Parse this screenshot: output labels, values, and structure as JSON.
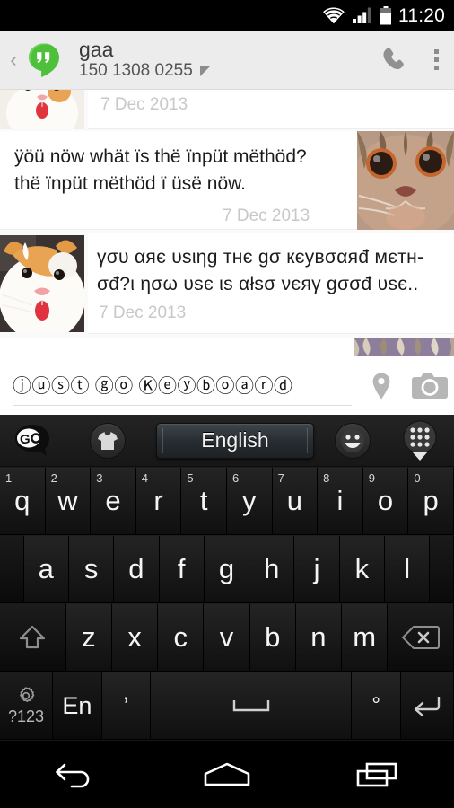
{
  "status_bar": {
    "time": "11:20",
    "icons": [
      "wifi-icon",
      "signal-icon",
      "battery-icon"
    ]
  },
  "action_bar": {
    "back_glyph": "‹",
    "app_icon": "hangouts-logo",
    "title": "gaa",
    "subtitle": "150 1308 0255",
    "call_icon": "phone-icon",
    "overflow_icon": "overflow-menu-icon"
  },
  "chat": {
    "messages": [
      {
        "id": "msg-1",
        "side": "left",
        "avatar": "cat-white-orange-avatar",
        "text": "",
        "timestamp": "7 Dec 2013"
      },
      {
        "id": "msg-2",
        "side": "right",
        "avatar": "cat-tabby-avatar",
        "text": "ÿöü nöw whät ïs thë ïnpüt mëthöd? thë ïnpüt mëthöd ï üsë nöw.",
        "line1": "ÿöü nöw whät ïs thë ïnpüt mëthöd?",
        "line2": "thë ïnpüt mëthöd ï üsë nöw.",
        "timestamp": "7 Dec 2013"
      },
      {
        "id": "msg-3",
        "side": "left",
        "avatar": "cat-orange-white-avatar",
        "text": "γσυ αяє υsιηg тнє gσ  кєувσαяđ мєтнσđ?ι ησω υsє ιs αłsσ νєяγ gσσđ υsє..",
        "line1": "γσυ αяє υsιηg тнє gσ  кєувσαяđ мєтн-",
        "line2": "σđ?ι ησω υsє ιs αłsσ νєяγ gσσđ υsє..",
        "timestamp": "7 Dec 2013"
      },
      {
        "id": "msg-4",
        "side": "right",
        "avatar": "cat-striped-avatar",
        "text": "",
        "timestamp": ""
      }
    ]
  },
  "compose": {
    "value": "ⓙⓤⓢⓣ ⓖⓞ Ⓚⓔⓨⓑⓞⓐⓡⓓ",
    "value_plain": "just go keyboard",
    "location_icon": "location-pin-icon",
    "camera_icon": "camera-icon"
  },
  "keyboard": {
    "toolbar": {
      "go_logo": "go-keyboard-logo",
      "go_text": "Go",
      "theme_icon": "t-shirt-theme-icon",
      "language_label": "English",
      "emoji_icon": "emoji-face-icon",
      "apps_icon": "apps-grid-icon"
    },
    "row1": [
      {
        "key": "q",
        "alt": "1"
      },
      {
        "key": "w",
        "alt": "2"
      },
      {
        "key": "e",
        "alt": "3"
      },
      {
        "key": "r",
        "alt": "4"
      },
      {
        "key": "t",
        "alt": "5"
      },
      {
        "key": "y",
        "alt": "6"
      },
      {
        "key": "u",
        "alt": "7"
      },
      {
        "key": "i",
        "alt": "8"
      },
      {
        "key": "o",
        "alt": "9"
      },
      {
        "key": "p",
        "alt": "0"
      }
    ],
    "row2": [
      {
        "key": "a"
      },
      {
        "key": "s"
      },
      {
        "key": "d"
      },
      {
        "key": "f"
      },
      {
        "key": "g"
      },
      {
        "key": "h"
      },
      {
        "key": "j"
      },
      {
        "key": "k"
      },
      {
        "key": "l"
      }
    ],
    "row3": [
      {
        "key": "z"
      },
      {
        "key": "x"
      },
      {
        "key": "c"
      },
      {
        "key": "v"
      },
      {
        "key": "b"
      },
      {
        "key": "n"
      },
      {
        "key": "m"
      }
    ],
    "shift_icon": "shift-key-icon",
    "backspace_icon": "backspace-key-icon",
    "symbols_icon": "gear-icon",
    "symbols_label": "?123",
    "language_key_label": "En",
    "comma_label": "’",
    "space_icon": "space-bar-icon",
    "period_label": "°",
    "enter_icon": "enter-key-icon"
  },
  "nav_bar": {
    "back_icon": "nav-back-icon",
    "home_icon": "nav-home-icon",
    "recents_icon": "nav-recents-icon"
  },
  "colors": {
    "accent_green": "#4fc03c",
    "actionbar_bg": "#ececec",
    "chat_bg": "#fafafa",
    "keyboard_bg": "#191919",
    "timestamp_gray": "#c8c8c8"
  }
}
